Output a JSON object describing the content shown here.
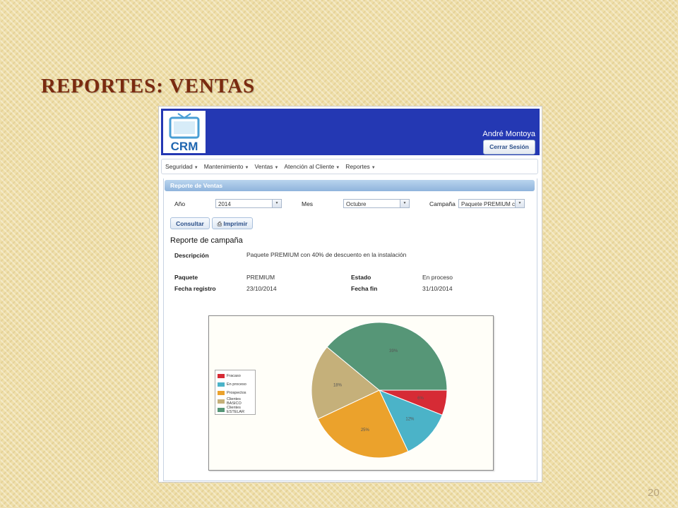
{
  "slide": {
    "title": "REPORTES: VENTAS",
    "number": "20"
  },
  "app": {
    "logo_text": "CRM",
    "user_name": "André Montoya",
    "logout_label": "Cerrar Sesión",
    "menu": [
      {
        "label": "Seguridad"
      },
      {
        "label": "Mantenimiento"
      },
      {
        "label": "Ventas"
      },
      {
        "label": "Atención al Cliente"
      },
      {
        "label": "Reportes"
      }
    ]
  },
  "panel": {
    "title": "Reporte de Ventas"
  },
  "filters": {
    "year_label": "Año",
    "year_value": "2014",
    "month_label": "Mes",
    "month_value": "Octubre",
    "campaign_label": "Campaña",
    "campaign_value": "Paquete PREMIUM co"
  },
  "actions": {
    "consult_label": "Consultar",
    "print_label": "Imprimir"
  },
  "report": {
    "section_title": "Reporte de campaña",
    "description_label": "Descripción",
    "description_value": "Paquete PREMIUM con 40% de descuento en la instalación",
    "package_label": "Paquete",
    "package_value": "PREMIUM",
    "status_label": "Estado",
    "status_value": "En proceso",
    "reg_date_label": "Fecha registro",
    "reg_date_value": "23/10/2014",
    "end_date_label": "Fecha fin",
    "end_date_value": "31/10/2014"
  },
  "colors": {
    "header_blue": "#2438b3",
    "title_red": "#7a2a10"
  },
  "chart_data": {
    "type": "pie",
    "title": "",
    "legend_position": "left",
    "slices": [
      {
        "name": "Fracaso",
        "value": 6,
        "label": "6%",
        "color": "#d62b35"
      },
      {
        "name": "En proceso",
        "value": 12,
        "label": "12%",
        "color": "#4bb3c8"
      },
      {
        "name": "Prospectos",
        "value": 25,
        "label": "25%",
        "color": "#eba22c"
      },
      {
        "name": "Clientes BASICO",
        "value": 18,
        "label": "18%",
        "color": "#c5b07a"
      },
      {
        "name": "Clientes ESTELAR",
        "value": 39,
        "label": "39%",
        "color": "#569677"
      }
    ]
  }
}
